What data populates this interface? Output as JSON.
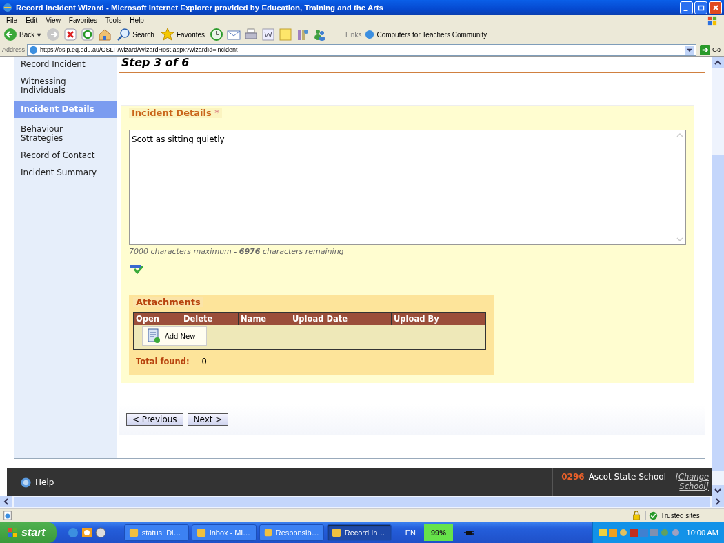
{
  "window": {
    "title": "Record Incident Wizard - Microsoft Internet Explorer provided by Education, Training and the Arts"
  },
  "menu": [
    "File",
    "Edit",
    "View",
    "Favorites",
    "Tools",
    "Help"
  ],
  "toolbar": {
    "back": "Back",
    "search": "Search",
    "favorites": "Favorites",
    "links_label": "Links",
    "link": "Computers for Teachers Community"
  },
  "address": {
    "label": "Address",
    "url": "https://oslp.eq.edu.au/OSLP/wizard/WizardHost.aspx?wizardId=incident",
    "go": "Go"
  },
  "sidebar": {
    "items": [
      {
        "label": "Record Incident",
        "selected": false
      },
      {
        "label": "Witnessing Individuals",
        "selected": false
      },
      {
        "label": "Incident Details",
        "selected": true
      },
      {
        "label": "Behaviour Strategies",
        "selected": false
      },
      {
        "label": "Record of Contact",
        "selected": false
      },
      {
        "label": "Incident Summary",
        "selected": false
      }
    ]
  },
  "step": "Step 3 of 6",
  "details": {
    "legend": "Incident Details",
    "required_mark": "*",
    "value": "Scott as sitting quietly",
    "counter": "7000 characters maximum - **6976** characters remaining"
  },
  "attachments": {
    "legend": "Attachments",
    "columns": [
      "Open",
      "Delete",
      "Name",
      "Upload Date",
      "Upload By"
    ],
    "add_button": "Add New",
    "total_label": "Total found:",
    "total": "0"
  },
  "buttons": [
    "< Previous",
    "Next >"
  ],
  "footer": {
    "help": "Help",
    "code": "0296",
    "school": "Ascot State School",
    "change": "[Change School]"
  },
  "status_bar": {
    "zone": "Trusted sites"
  },
  "taskbar": {
    "start": "start",
    "tasks": [
      {
        "label": "status: Di…",
        "selected": false
      },
      {
        "label": "Inbox - Mi…",
        "selected": false
      },
      {
        "label": "Responsib…",
        "selected": false
      },
      {
        "label": "Record In…",
        "selected": true
      }
    ],
    "language": "EN",
    "battery": "99%",
    "clock": "10:00 AM"
  }
}
